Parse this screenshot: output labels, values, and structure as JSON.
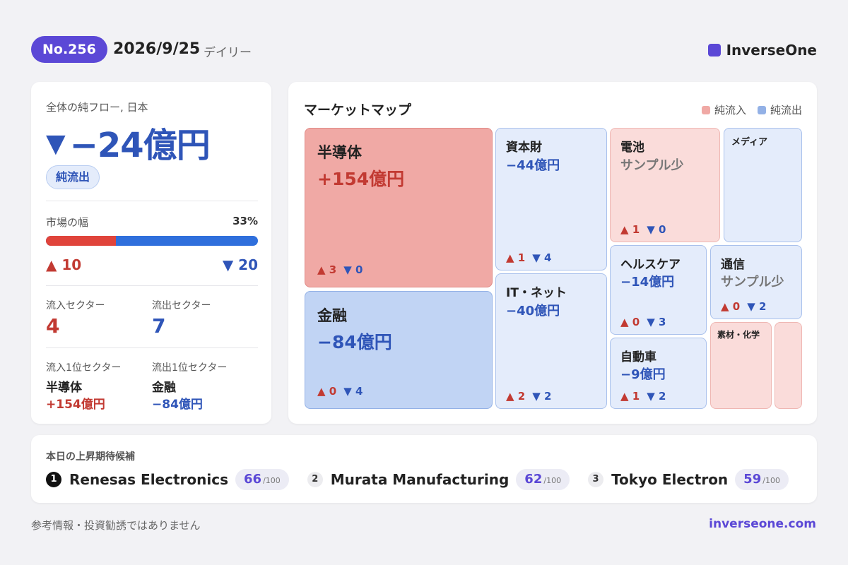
{
  "header": {
    "issue": "No.256",
    "date": "2026/9/25",
    "frequency": "デイリー",
    "brand": "InverseOne"
  },
  "summary": {
    "label": "全体の純フロー, 日本",
    "arrow": "▼",
    "value": "−24億円",
    "badge": "純流出",
    "breadth_label": "市場の幅",
    "breadth_pct": "33%",
    "breadth_fraction": 0.33,
    "advancers": "▲ 10",
    "decliners": "▼ 20",
    "inflow_sectors_label": "流入セクター",
    "inflow_sectors": "4",
    "outflow_sectors_label": "流出セクター",
    "outflow_sectors": "7",
    "top_inflow_label": "流入1位セクター",
    "top_inflow_name": "半導体",
    "top_inflow_value": "+154億円",
    "top_outflow_label": "流出1位セクター",
    "top_outflow_name": "金融",
    "top_outflow_value": "−84億円"
  },
  "market_map": {
    "title": "マーケットマップ",
    "legend_inflow": "純流入",
    "legend_outflow": "純流出",
    "tiles": {
      "semiconductors": {
        "name": "半導体",
        "value": "+154億円",
        "up": "▲ 3",
        "down": "▼ 0"
      },
      "finance": {
        "name": "金融",
        "value": "−84億円",
        "up": "▲ 0",
        "down": "▼ 4"
      },
      "capital_goods": {
        "name": "資本財",
        "value": "−44億円",
        "up": "▲ 1",
        "down": "▼ 4"
      },
      "it_net": {
        "name": "IT・ネット",
        "value": "−40億円",
        "up": "▲ 2",
        "down": "▼ 2"
      },
      "batteries": {
        "name": "電池",
        "value": "サンプル少",
        "up": "▲ 1",
        "down": "▼ 0"
      },
      "media": {
        "name": "メディア"
      },
      "healthcare": {
        "name": "ヘルスケア",
        "value": "−14億円",
        "up": "▲ 0",
        "down": "▼ 3"
      },
      "telecom": {
        "name": "通信",
        "value": "サンプル少",
        "up": "▲ 0",
        "down": "▼ 2"
      },
      "autos": {
        "name": "自動車",
        "value": "−9億円",
        "up": "▲ 1",
        "down": "▼ 2"
      },
      "materials": {
        "name": "素材・化学"
      }
    }
  },
  "candidates": {
    "title": "本日の上昇期待候補",
    "denominator": "/100",
    "items": [
      {
        "rank": "1",
        "name": "Renesas Electronics",
        "score": "66"
      },
      {
        "rank": "2",
        "name": "Murata Manufacturing",
        "score": "62"
      },
      {
        "rank": "3",
        "name": "Tokyo Electron",
        "score": "59"
      }
    ]
  },
  "footer": {
    "disclaimer": "参考情報・投資勧誘ではありません",
    "url": "inverseone.com"
  },
  "colors": {
    "accent": "#5b48d6",
    "inflow": "#c23a32",
    "outflow": "#2f55b8"
  }
}
